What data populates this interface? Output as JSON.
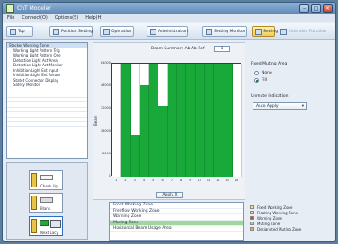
{
  "window": {
    "title": "ChT Modeler"
  },
  "menu": [
    "File",
    "Connect(O)",
    "Options(S)",
    "Help(H)"
  ],
  "toolbar": {
    "buttons": [
      {
        "label": "Top",
        "state": "normal"
      },
      {
        "label": "Position Setting",
        "state": "normal"
      },
      {
        "label": "Operation",
        "state": "normal"
      },
      {
        "label": "Administration",
        "state": "normal"
      },
      {
        "label": "Setting Monitor",
        "state": "normal"
      },
      {
        "label": "Setting",
        "state": "active"
      },
      {
        "label": "Extended Function",
        "state": "disabled"
      }
    ]
  },
  "tree": {
    "items": [
      {
        "label": "Stacker Working Zone",
        "level": 0,
        "selected": true
      },
      {
        "label": "Working Light Pattern Trig",
        "level": 1
      },
      {
        "label": "Working Light Pattern One",
        "level": 1
      },
      {
        "label": "Detection Light Act Area",
        "level": 1
      },
      {
        "label": "Detection Light Act Monitor",
        "level": 1
      },
      {
        "label": "Inhibition Light Ext Input",
        "level": 1
      },
      {
        "label": "Inhibition Light Ext Return",
        "level": 1
      },
      {
        "label": "Statet Connector Display",
        "level": 1
      },
      {
        "label": "Safety Monitor",
        "level": 1
      }
    ]
  },
  "modes": [
    {
      "label": "Check Up"
    },
    {
      "label": "Blank"
    },
    {
      "label": "Next Lacy"
    }
  ],
  "chart": {
    "header_label": "Beam Summary Ab Ab Ref",
    "header_value": "1",
    "ylabel": "Beam",
    "x_button": "Apply X",
    "y_ticks": [
      "64000",
      "48000",
      "32000",
      "16000",
      "8000",
      "1"
    ]
  },
  "chart_data": {
    "type": "heatmap",
    "columns": 14,
    "rows": 16,
    "white_cells_by_column": [
      [
        0,
        1,
        2,
        3,
        4,
        5,
        6,
        7,
        8,
        9,
        10,
        11,
        12,
        13,
        14,
        15
      ],
      [],
      [
        0,
        1,
        2,
        3,
        4,
        5,
        6,
        7,
        8,
        9
      ],
      [
        0,
        1,
        2
      ],
      [],
      [
        0,
        1,
        2,
        3,
        4,
        5
      ],
      [],
      [],
      [],
      [],
      [],
      [],
      [],
      [
        0,
        1,
        2,
        3,
        4,
        5,
        6,
        7,
        8,
        9,
        10,
        11,
        12,
        13,
        14,
        15
      ]
    ],
    "x_tick_labels": [
      "1",
      "2",
      "3",
      "4",
      "5",
      "6",
      "7",
      "8",
      "9",
      "10",
      "11",
      "12",
      "13",
      "14"
    ],
    "fill_color": "#19a83a",
    "empty_color": "#ffffff"
  },
  "zone_list": {
    "rows": [
      {
        "label": "Front Working Zone",
        "selected": false
      },
      {
        "label": "Freeflow Working Zone",
        "selected": false
      },
      {
        "label": "Warning Zone",
        "selected": false
      },
      {
        "label": "Muting Zone",
        "selected": true
      },
      {
        "label": "Horizontal Beam Usage Area",
        "selected": false
      }
    ]
  },
  "right_panel": {
    "group1_title": "Fixed Muting Area",
    "options": [
      {
        "label": "None",
        "checked": false
      },
      {
        "label": "Fill",
        "checked": true
      }
    ],
    "group2_title": "Unmute Indication",
    "dropdown_value": "Auto Apply"
  },
  "legend": [
    {
      "label": "Fixed Working Zone",
      "color": "#f4e96a"
    },
    {
      "label": "Floating Working Zone",
      "color": "#f0d7a2"
    },
    {
      "label": "Warning Zone",
      "color": "#d93a2f"
    },
    {
      "label": "Muting Zone",
      "color": "#9fd89a"
    },
    {
      "label": "Designated Muting Zone",
      "color": "#e7b33f"
    }
  ]
}
